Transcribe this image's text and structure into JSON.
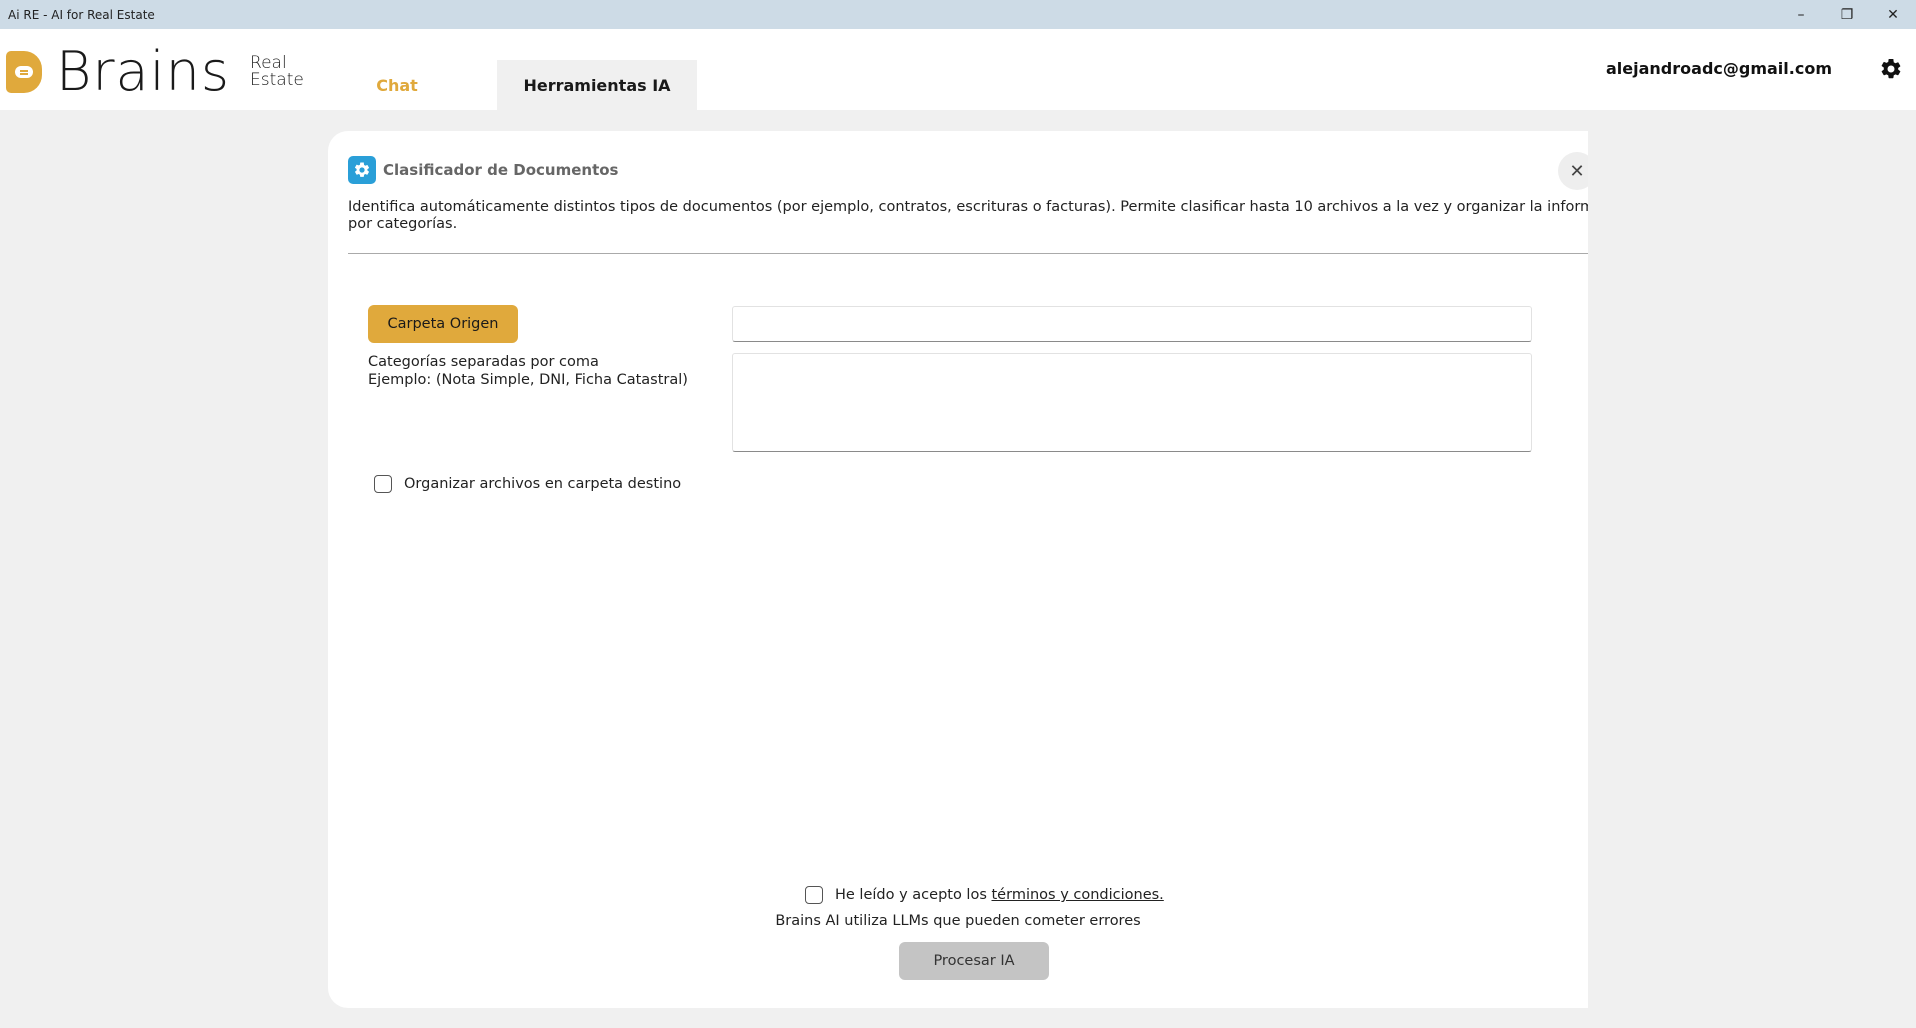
{
  "window": {
    "title": "Ai RE - AI for Real Estate",
    "minimize": "–",
    "restore": "❐",
    "close": "✕"
  },
  "header": {
    "logo_text": "Brains",
    "logo_sub_line1": "Real",
    "logo_sub_line2": "Estate",
    "tabs": [
      {
        "label": "Chat",
        "active": false
      },
      {
        "label": "Herramientas IA",
        "active": true
      }
    ],
    "user_email": "alejandroadc@gmail.com",
    "settings_icon": "gear-icon"
  },
  "tool": {
    "icon": "gear-icon",
    "title": "Clasificador de Documentos",
    "close_label": "✕",
    "description": "Identifica automáticamente distintos tipos de documentos (por ejemplo, contratos, escrituras o facturas). Permite clasificar hasta 10 archivos a la vez y organizar la información por categorías.",
    "origin_button": "Carpeta Origen",
    "origin_value": "",
    "categories_label_line1": "Categorías separadas por coma",
    "categories_label_line2": "Ejemplo: (Nota Simple, DNI, Ficha Catastral)",
    "categories_value": "",
    "organize_label": "Organizar archivos en carpeta destino",
    "organize_checked": false,
    "terms_prefix": "He leído y acepto los ",
    "terms_link": "términos y condiciones.",
    "terms_checked": false,
    "disclaimer": "Brains AI utiliza LLMs que pueden cometer errores",
    "process_button": "Procesar IA"
  },
  "colors": {
    "accent": "#e0a93c",
    "tool_icon_bg": "#2a9fd8",
    "disabled_button": "#c4c4c4",
    "titlebar": "#cddbe6"
  }
}
